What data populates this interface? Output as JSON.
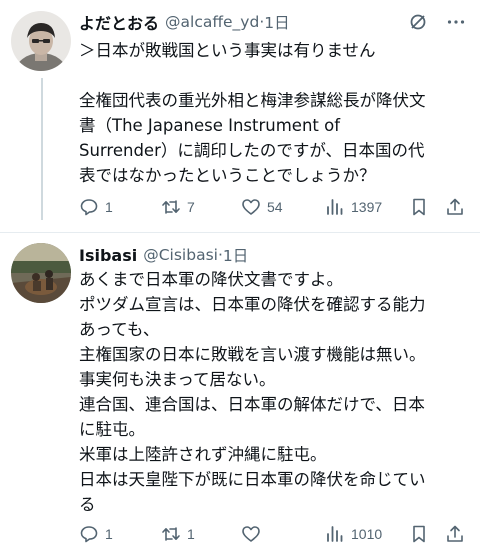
{
  "tweets": [
    {
      "author": "よだとおる",
      "handle": "@alcaffe_yd",
      "separator": "·",
      "time": "1日",
      "lines": [
        "＞日本が敗戦国という事実は有りません",
        "",
        "全権団代表の重光外相と梅津参謀総長が降伏文",
        "書（The Japanese Instrument of",
        "Surrender）に調印したのですが、日本国の代",
        "表ではなかったということでしょうか？"
      ],
      "replies": "1",
      "reposts": "7",
      "likes": "54",
      "views": "1397"
    },
    {
      "author": "Isibasi",
      "handle": "@Cisibasi",
      "separator": "·",
      "time": "1日",
      "lines": [
        "あくまで日本軍の降伏文書ですよ。",
        "ポツダム宣言は、日本軍の降伏を確認する能力",
        "あっても、",
        "主権国家の日本に敗戦を言い渡す機能は無い。",
        "事実何も決まって居ない。",
        "連合国、連合国は、日本軍の解体だけで、日本",
        "に駐屯。",
        "米軍は上陸許されず沖縄に駐屯。",
        "日本は天皇陛下が既に日本軍の降伏を命じてい",
        "る"
      ],
      "replies": "1",
      "reposts": "1",
      "likes": "",
      "views": "1010"
    }
  ],
  "icons": {
    "reply": "reply-icon",
    "repost": "repost-icon",
    "like": "heart-icon",
    "views": "views-icon",
    "bookmark": "bookmark-icon",
    "share": "share-icon",
    "grok": "grok-icon",
    "more": "more-icon"
  },
  "colors": {
    "text": "#0f1419",
    "secondary": "#536471",
    "thread_line": "#cfd9de"
  }
}
